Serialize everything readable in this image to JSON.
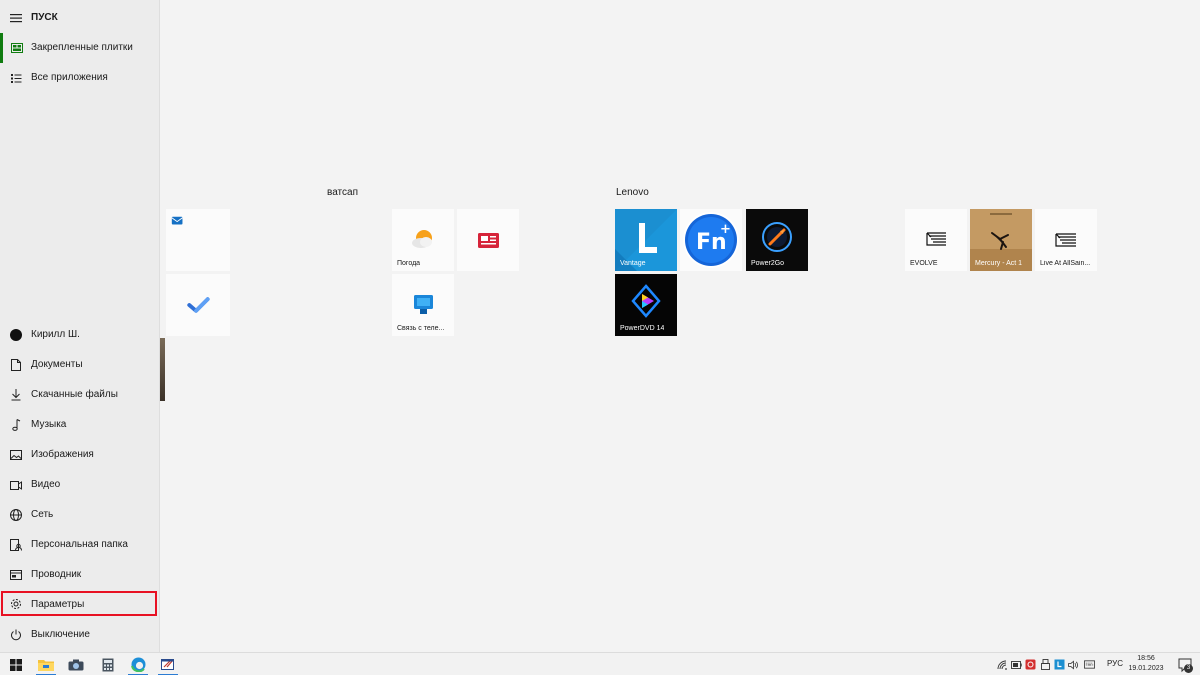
{
  "rail": {
    "title": "ПУСК",
    "pinned_tiles": "Закрепленные плитки",
    "all_apps": "Все приложения",
    "user": "Кирилл Ш.",
    "documents": "Документы",
    "downloads": "Скачанные файлы",
    "music": "Музыка",
    "pictures": "Изображения",
    "videos": "Видео",
    "network": "Сеть",
    "personal_folder": "Персональная папка",
    "explorer": "Проводник",
    "settings": "Параметры",
    "power": "Выключение"
  },
  "groups": {
    "whatsapp": "ватсап",
    "lenovo": "Lenovo"
  },
  "tiles": {
    "weather": "Погода",
    "phone_link": "Связь с теле...",
    "vantage": "Vantage",
    "power2go": "Power2Go",
    "powerdvd": "PowerDVD 14",
    "evolve": "EVOLVE",
    "mercury": "Mercury - Act 1",
    "live_allsaints": "Live At AllSain..."
  },
  "taskbar": {
    "language": "РУС",
    "time": "18:56",
    "date": "19.01.2023",
    "notification_count": "3"
  },
  "colors": {
    "accent_green": "#107c10",
    "highlight_red": "#e81123",
    "vantage_blue": "#1b8fd1",
    "fn_blue": "#1565d8"
  }
}
